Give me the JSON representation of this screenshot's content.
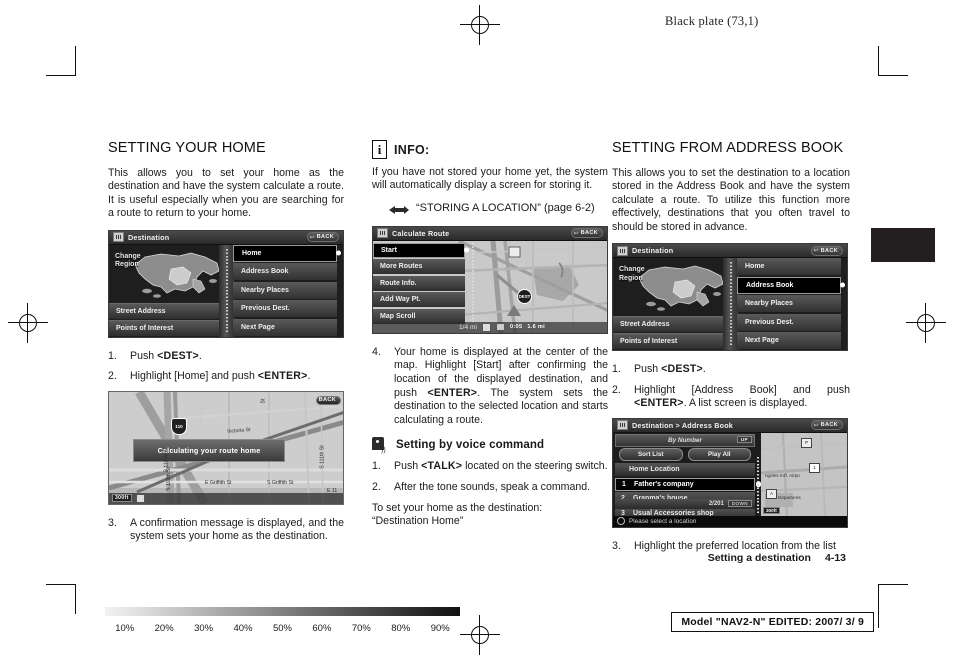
{
  "page": {
    "black_plate": "Black plate (73,1)",
    "footer_section": "Setting a destination",
    "footer_page": "4-13",
    "model_box": "Model \"NAV2-N\"  EDITED:  2007/ 3/ 9",
    "gradient_labels": [
      "10%",
      "20%",
      "30%",
      "40%",
      "50%",
      "60%",
      "70%",
      "80%",
      "90%"
    ]
  },
  "col1": {
    "heading": "SETTING YOUR HOME",
    "intro": "This allows you to set your home as the destination and have the system calculate a route. It is useful especially when you are searching for a route to return to your home.",
    "steps": [
      {
        "num": "1.",
        "html": "Push <b>&lt;DEST&gt;</b>."
      },
      {
        "num": "2.",
        "html": "Highlight [Home] and push <b>&lt;ENTER&gt;</b>."
      },
      {
        "num": "3.",
        "html": "A confirmation message is displayed, and the system sets your home as the destination."
      }
    ],
    "dest_screen": {
      "title": "Destination",
      "back": "BACK",
      "change_region": "Change\nRegion",
      "left_buttons": [
        "Street Address",
        "Points of Interest"
      ],
      "right_buttons": [
        "Home",
        "Address Book",
        "Nearby Places",
        "Previous Dest.",
        "Next Page"
      ],
      "selected": "Home"
    },
    "map_screen": {
      "toast": "Calculating your route home",
      "back": "BACK",
      "scale": "300ft",
      "shield": "I-110",
      "streets": [
        "Victoria St",
        "E Griffith St",
        "S Griffith St",
        "S 110 Ave",
        "St",
        "S 110th St",
        "E 11"
      ]
    }
  },
  "col2": {
    "info_title": "INFO:",
    "info_icon_letter": "i",
    "info_body": "If you have not stored your home yet, the system will automatically display a screen for storing it.",
    "info_ref": "“STORING A LOCATION” (page 6-2)",
    "calc_screen": {
      "title": "Calculate Route",
      "back": "BACK",
      "buttons": [
        "Start",
        "More Routes",
        "Route Info.",
        "Add Way Pt.",
        "Map Scroll"
      ],
      "selected": "Start",
      "scale": "1/4 mi",
      "eta": "0:05",
      "distance": "1.6 mi"
    },
    "step4": {
      "num": "4.",
      "html": "Your home is displayed at the center of the map. Highlight [Start] after confirming the location of the displayed destination, and push <b>&lt;ENTER&gt;</b>. The system sets the destination to the selected location and starts calculating a route."
    },
    "voice_title": "Setting by voice command",
    "voice_steps": [
      {
        "num": "1.",
        "html": "Push <b>&lt;TALK&gt;</b> located on the steering switch."
      },
      {
        "num": "2.",
        "html": "After the tone sounds, speak a command."
      }
    ],
    "voice_note_1": "To set your home as the destination:",
    "voice_note_2": "“Destination Home”"
  },
  "col3": {
    "heading": "SETTING FROM ADDRESS BOOK",
    "intro": "This allows you to set the destination to a location stored in the Address Book and have the system calculate a route. To utilize this function more effectively, destinations that you often travel to should be stored in advance.",
    "steps": [
      {
        "num": "1.",
        "html": "Push <b>&lt;DEST&gt;</b>."
      },
      {
        "num": "2.",
        "html": "Highlight [Address Book] and push <b>&lt;ENTER&gt;</b>. A list screen is displayed."
      },
      {
        "num": "3.",
        "html": "Highlight the preferred location from the list"
      }
    ],
    "dest_screen": {
      "title": "Destination",
      "back": "BACK",
      "change_region": "Change\nRegion",
      "left_buttons": [
        "Street Address",
        "Points of Interest"
      ],
      "right_buttons": [
        "Home",
        "Address Book",
        "Nearby Places",
        "Previous Dest.",
        "Next Page"
      ],
      "selected": "Address Book"
    },
    "ab_screen": {
      "title": "Destination > Address Book",
      "back": "BACK",
      "sort_label": "By Number",
      "up_button": "UP",
      "pills": [
        "Sort List",
        "Play All"
      ],
      "home_item": "Home Location",
      "items": [
        {
          "idx": "1",
          "label": "Father's company"
        },
        {
          "idx": "2",
          "label": "Granma's house"
        },
        {
          "idx": "3",
          "label": "Usual Accessories shop"
        }
      ],
      "selected": "Father's company",
      "page": "2/201",
      "down_button": "DOWN",
      "status": "Please select a location",
      "map_scale": "300ft",
      "map_labels": [
        "Angeles  Int'l.  Airpo",
        "Departures",
        "P",
        "A",
        "1"
      ]
    }
  }
}
